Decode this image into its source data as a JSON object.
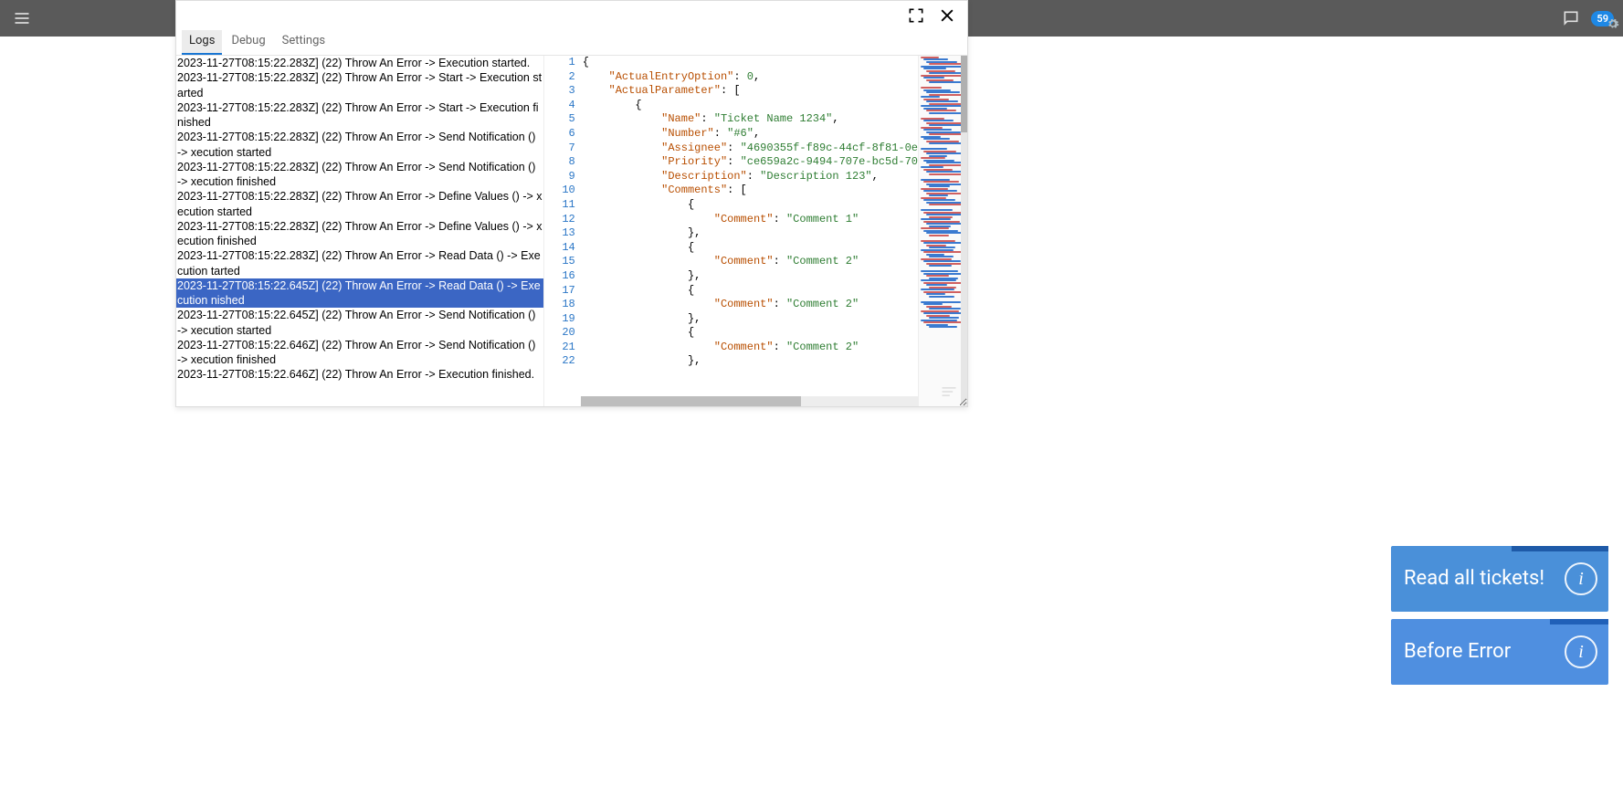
{
  "header": {
    "notification_count": "59"
  },
  "tabs": {
    "logs": "Logs",
    "debug": "Debug",
    "settings": "Settings"
  },
  "logs": [
    {
      "t": "2023-11-27T08:15:22.283Z] (22) Throw An Error -> Execution started.",
      "sel": false
    },
    {
      "t": "2023-11-27T08:15:22.283Z] (22) Throw An Error -> Start -> Execution started",
      "sel": false
    },
    {
      "t": "2023-11-27T08:15:22.283Z] (22) Throw An Error -> Start -> Execution finished",
      "sel": false
    },
    {
      "t": "2023-11-27T08:15:22.283Z] (22) Throw An Error -> Send Notification () -> xecution started",
      "sel": false
    },
    {
      "t": "2023-11-27T08:15:22.283Z] (22) Throw An Error -> Send Notification () -> xecution finished",
      "sel": false
    },
    {
      "t": "2023-11-27T08:15:22.283Z] (22) Throw An Error -> Define Values () -> xecution started",
      "sel": false
    },
    {
      "t": "2023-11-27T08:15:22.283Z] (22) Throw An Error -> Define Values () -> xecution finished",
      "sel": false
    },
    {
      "t": "2023-11-27T08:15:22.283Z] (22) Throw An Error -> Read Data () -> Execution tarted",
      "sel": false
    },
    {
      "t": "2023-11-27T08:15:22.645Z] (22) Throw An Error -> Read Data () -> Execution nished",
      "sel": true
    },
    {
      "t": "2023-11-27T08:15:22.645Z] (22) Throw An Error -> Send Notification () -> xecution started",
      "sel": false
    },
    {
      "t": "2023-11-27T08:15:22.646Z] (22) Throw An Error -> Send Notification () -> xecution finished",
      "sel": false
    },
    {
      "t": "2023-11-27T08:15:22.646Z] (22) Throw An Error -> Execution finished.",
      "sel": false
    }
  ],
  "json_lines": [
    [
      {
        "p": "{"
      }
    ],
    [
      {
        "p": "    "
      },
      {
        "k": "\"ActualEntryOption\""
      },
      {
        "p": ": "
      },
      {
        "n": "0"
      },
      {
        "p": ","
      }
    ],
    [
      {
        "p": "    "
      },
      {
        "k": "\"ActualParameter\""
      },
      {
        "p": ": ["
      }
    ],
    [
      {
        "p": "        {"
      }
    ],
    [
      {
        "p": "            "
      },
      {
        "k": "\"Name\""
      },
      {
        "p": ": "
      },
      {
        "s": "\"Ticket Name 1234\""
      },
      {
        "p": ","
      }
    ],
    [
      {
        "p": "            "
      },
      {
        "k": "\"Number\""
      },
      {
        "p": ": "
      },
      {
        "s": "\"#6\""
      },
      {
        "p": ","
      }
    ],
    [
      {
        "p": "            "
      },
      {
        "k": "\"Assignee\""
      },
      {
        "p": ": "
      },
      {
        "s": "\"4690355f-f89c-44cf-8f81-0e"
      }
    ],
    [
      {
        "p": "            "
      },
      {
        "k": "\"Priority\""
      },
      {
        "p": ": "
      },
      {
        "s": "\"ce659a2c-9494-707e-bc5d-70"
      }
    ],
    [
      {
        "p": "            "
      },
      {
        "k": "\"Description\""
      },
      {
        "p": ": "
      },
      {
        "s": "\"Description 123\""
      },
      {
        "p": ","
      }
    ],
    [
      {
        "p": "            "
      },
      {
        "k": "\"Comments\""
      },
      {
        "p": ": ["
      }
    ],
    [
      {
        "p": "                {"
      }
    ],
    [
      {
        "p": "                    "
      },
      {
        "k": "\"Comment\""
      },
      {
        "p": ": "
      },
      {
        "s": "\"Comment 1\""
      }
    ],
    [
      {
        "p": "                },"
      }
    ],
    [
      {
        "p": "                {"
      }
    ],
    [
      {
        "p": "                    "
      },
      {
        "k": "\"Comment\""
      },
      {
        "p": ": "
      },
      {
        "s": "\"Comment 2\""
      }
    ],
    [
      {
        "p": "                },"
      }
    ],
    [
      {
        "p": "                {"
      }
    ],
    [
      {
        "p": "                    "
      },
      {
        "k": "\"Comment\""
      },
      {
        "p": ": "
      },
      {
        "s": "\"Comment 2\""
      }
    ],
    [
      {
        "p": "                },"
      }
    ],
    [
      {
        "p": "                {"
      }
    ],
    [
      {
        "p": "                    "
      },
      {
        "k": "\"Comment\""
      },
      {
        "p": ": "
      },
      {
        "s": "\"Comment 2\""
      }
    ],
    [
      {
        "p": "                },"
      }
    ]
  ],
  "line_count": 22,
  "cards": {
    "read_all": "Read all tickets!",
    "before_error": "Before Error"
  }
}
